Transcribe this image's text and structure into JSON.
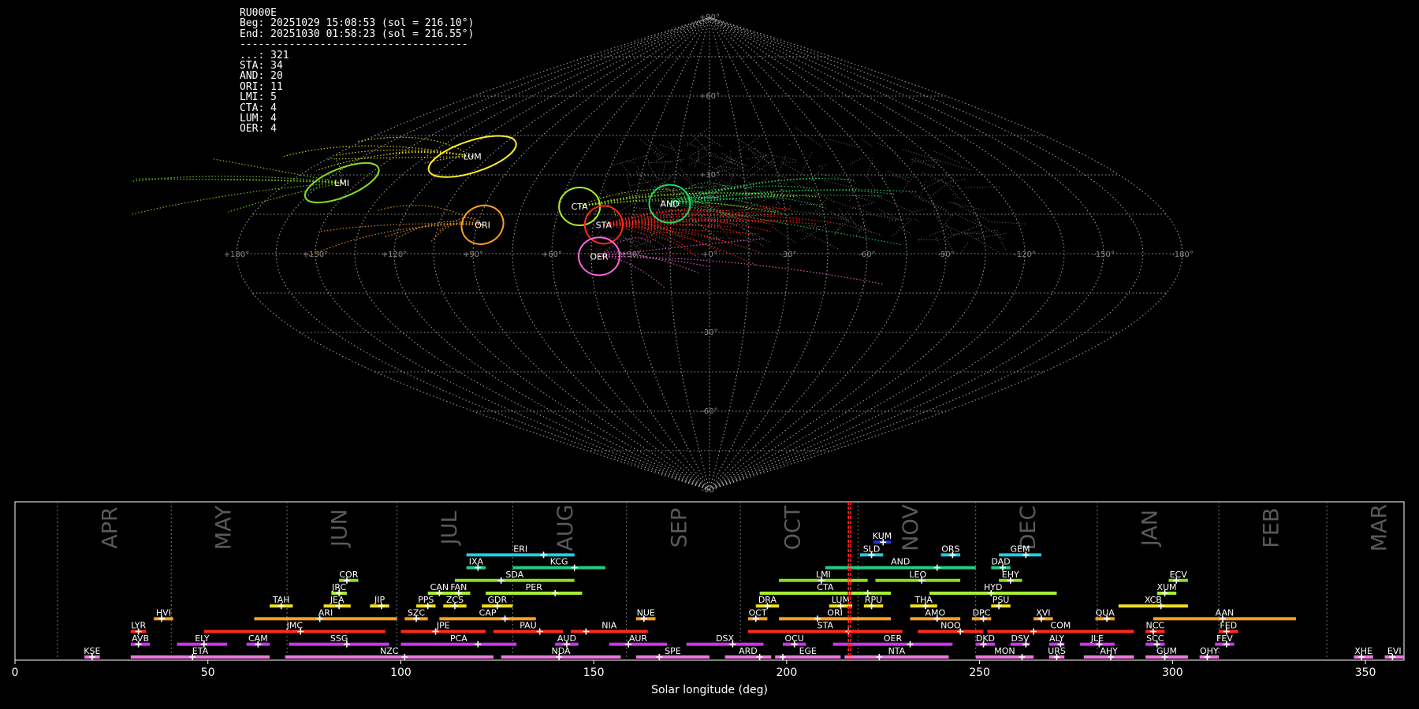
{
  "station": "RU000E",
  "beg_line": "Beg: 20251029 15:08:53 (sol = 216.10°)",
  "end_line": "End: 20251030 01:58:23 (sol = 216.55°)",
  "separator": "-------------------------------------",
  "counts": [
    {
      "code": "...",
      "n": 321
    },
    {
      "code": "STA",
      "n": 34
    },
    {
      "code": "AND",
      "n": 20
    },
    {
      "code": "ORI",
      "n": 11
    },
    {
      "code": "LMI",
      "n": 5
    },
    {
      "code": "CTA",
      "n": 4
    },
    {
      "code": "LUM",
      "n": 4
    },
    {
      "code": "OER",
      "n": 4
    }
  ],
  "colors": {
    "background": "#000000",
    "grid": "#9a9a9a",
    "sporadic": "#8a8a8a",
    "current": "#ff2020"
  },
  "chart_data": [
    {
      "type": "scatter",
      "projection": "sinusoidal",
      "lon_ticks": [
        "+180°",
        "+150°",
        "+120°",
        "+90°",
        "+60°",
        "+30°",
        "+0°",
        "-30°",
        "-60°",
        "-90°",
        "-120°",
        "-150°",
        "-180°"
      ],
      "lat_ticks": [
        "+90°",
        "+60°",
        "+30°",
        "-30°",
        "-60°",
        "-90°"
      ],
      "showers": [
        {
          "code": "LUM",
          "lon": 113,
          "lat": 37,
          "color": "#ffee22"
        },
        {
          "code": "LMI",
          "lon": 157,
          "lat": 27,
          "color": "#88dd22"
        },
        {
          "code": "CTA",
          "lon": 52,
          "lat": 18,
          "color": "#aaee22"
        },
        {
          "code": "AND",
          "lon": 16,
          "lat": 19,
          "color": "#22dd66"
        },
        {
          "code": "ORI",
          "lon": 88,
          "lat": 11,
          "color": "#ffa020"
        },
        {
          "code": "STA",
          "lon": 41,
          "lat": 11,
          "color": "#ff2a1a"
        },
        {
          "code": "OER",
          "lon": 42,
          "lat": -1,
          "color": "#ff66dd"
        }
      ]
    },
    {
      "type": "bar",
      "title": "",
      "xlabel": "Solar longitude (deg)",
      "xlim": [
        0,
        360
      ],
      "xticks": [
        0,
        50,
        100,
        150,
        200,
        250,
        300,
        350
      ],
      "current_sol": 216.3,
      "months": [
        {
          "name": "APR",
          "sol": 11
        },
        {
          "name": "MAY",
          "sol": 40.5
        },
        {
          "name": "JUN",
          "sol": 70.5
        },
        {
          "name": "JUL",
          "sol": 99
        },
        {
          "name": "AUG",
          "sol": 129
        },
        {
          "name": "SEP",
          "sol": 158.5
        },
        {
          "name": "OCT",
          "sol": 188
        },
        {
          "name": "NOV",
          "sol": 218.5
        },
        {
          "name": "DEC",
          "sol": 249
        },
        {
          "name": "JAN",
          "sol": 280.5
        },
        {
          "name": "FEB",
          "sol": 312
        },
        {
          "name": "MAR",
          "sol": 340
        }
      ],
      "showers": [
        {
          "code": "KUM",
          "start": 222.5,
          "end": 227,
          "peak": 225,
          "row": 10,
          "color": "#2233dd"
        },
        {
          "code": "ERI",
          "start": 117,
          "end": 145,
          "peak": 137,
          "row": 9,
          "color": "#22ccdd"
        },
        {
          "code": "SLD",
          "start": 219,
          "end": 225,
          "peak": 222,
          "row": 9,
          "color": "#22ccdd"
        },
        {
          "code": "ORS",
          "start": 240,
          "end": 245,
          "peak": 243,
          "row": 9,
          "color": "#22ccdd"
        },
        {
          "code": "GEM",
          "start": 255,
          "end": 266,
          "peak": 262,
          "row": 9,
          "color": "#22ccdd"
        },
        {
          "code": "IXA",
          "start": 117,
          "end": 122,
          "peak": 120,
          "row": 8,
          "color": "#22cc88"
        },
        {
          "code": "KCG",
          "start": 129,
          "end": 153,
          "peak": 145,
          "row": 8,
          "color": "#22cc88"
        },
        {
          "code": "AND",
          "start": 210,
          "end": 249,
          "peak": 239,
          "row": 8,
          "color": "#22cc88"
        },
        {
          "code": "DAD",
          "start": 253,
          "end": 258,
          "peak": 256,
          "row": 8,
          "color": "#22cc88"
        },
        {
          "code": "COR",
          "start": 84,
          "end": 89,
          "peak": 86,
          "row": 7,
          "color": "#88dd22"
        },
        {
          "code": "SDA",
          "start": 114,
          "end": 145,
          "peak": 126,
          "row": 7,
          "color": "#88dd22"
        },
        {
          "code": "LMI",
          "start": 198,
          "end": 221,
          "peak": 209,
          "row": 7,
          "color": "#88dd22"
        },
        {
          "code": "LEO",
          "start": 223,
          "end": 245,
          "peak": 235,
          "row": 7,
          "color": "#88dd22"
        },
        {
          "code": "EHY",
          "start": 255,
          "end": 261,
          "peak": 258,
          "row": 7,
          "color": "#88dd22"
        },
        {
          "code": "ECV",
          "start": 299,
          "end": 304,
          "peak": 301,
          "row": 7,
          "color": "#88dd22"
        },
        {
          "code": "JRC",
          "start": 82,
          "end": 86,
          "peak": 84,
          "row": 6,
          "color": "#aaee33"
        },
        {
          "code": "CAN",
          "start": 107,
          "end": 113,
          "peak": 110,
          "row": 6,
          "color": "#aaee33"
        },
        {
          "code": "FAN",
          "start": 112,
          "end": 118,
          "peak": 115,
          "row": 6,
          "color": "#aaee33"
        },
        {
          "code": "PER",
          "start": 122,
          "end": 147,
          "peak": 140,
          "row": 6,
          "color": "#aaee33"
        },
        {
          "code": "CTA",
          "start": 193,
          "end": 227,
          "peak": 221,
          "row": 6,
          "color": "#aaee33"
        },
        {
          "code": "HYD",
          "start": 237,
          "end": 270,
          "peak": 253,
          "row": 6,
          "color": "#aaee33"
        },
        {
          "code": "XUM",
          "start": 296,
          "end": 301,
          "peak": 298,
          "row": 6,
          "color": "#aaee33"
        },
        {
          "code": "TAH",
          "start": 66,
          "end": 72,
          "peak": 69,
          "row": 5,
          "color": "#eedd22"
        },
        {
          "code": "JEA",
          "start": 80,
          "end": 87,
          "peak": 84,
          "row": 5,
          "color": "#eedd22"
        },
        {
          "code": "JIP",
          "start": 92,
          "end": 97,
          "peak": 95,
          "row": 5,
          "color": "#eedd22"
        },
        {
          "code": "PPS",
          "start": 104,
          "end": 109,
          "peak": 107,
          "row": 5,
          "color": "#eedd22"
        },
        {
          "code": "ZCS",
          "start": 111,
          "end": 117,
          "peak": 114,
          "row": 5,
          "color": "#eedd22"
        },
        {
          "code": "GDR",
          "start": 121,
          "end": 129,
          "peak": 125,
          "row": 5,
          "color": "#eedd22"
        },
        {
          "code": "DRA",
          "start": 192,
          "end": 198,
          "peak": 195,
          "row": 5,
          "color": "#eedd22"
        },
        {
          "code": "LUM",
          "start": 211,
          "end": 217,
          "peak": 214,
          "row": 5,
          "color": "#eedd22"
        },
        {
          "code": "RPU",
          "start": 220,
          "end": 225,
          "peak": 222,
          "row": 5,
          "color": "#eedd22"
        },
        {
          "code": "THA",
          "start": 232,
          "end": 239,
          "peak": 236,
          "row": 5,
          "color": "#eedd22"
        },
        {
          "code": "PSU",
          "start": 253,
          "end": 258,
          "peak": 255,
          "row": 5,
          "color": "#eedd22"
        },
        {
          "code": "XCB",
          "start": 286,
          "end": 304,
          "peak": 297,
          "row": 5,
          "color": "#eedd22"
        },
        {
          "code": "HVI",
          "start": 36,
          "end": 41,
          "peak": 38,
          "row": 4,
          "color": "#ffa020"
        },
        {
          "code": "ARI",
          "start": 62,
          "end": 99,
          "peak": 79,
          "row": 4,
          "color": "#ffa020"
        },
        {
          "code": "SZC",
          "start": 101,
          "end": 107,
          "peak": 104,
          "row": 4,
          "color": "#ffa020"
        },
        {
          "code": "CAP",
          "start": 110,
          "end": 135,
          "peak": 127,
          "row": 4,
          "color": "#ffa020"
        },
        {
          "code": "NUE",
          "start": 161,
          "end": 166,
          "peak": 163,
          "row": 4,
          "color": "#ffa020"
        },
        {
          "code": "OCT",
          "start": 190,
          "end": 195,
          "peak": 192,
          "row": 4,
          "color": "#ffa020"
        },
        {
          "code": "ORI",
          "start": 198,
          "end": 227,
          "peak": 208,
          "row": 4,
          "color": "#ffa020"
        },
        {
          "code": "AMO",
          "start": 232,
          "end": 245,
          "peak": 239,
          "row": 4,
          "color": "#ffa020"
        },
        {
          "code": "DPC",
          "start": 248,
          "end": 253,
          "peak": 251,
          "row": 4,
          "color": "#ffa020"
        },
        {
          "code": "XVI",
          "start": 264,
          "end": 269,
          "peak": 266,
          "row": 4,
          "color": "#ffa020"
        },
        {
          "code": "QUA",
          "start": 280,
          "end": 285,
          "peak": 283,
          "row": 4,
          "color": "#ffa020"
        },
        {
          "code": "AAN",
          "start": 295,
          "end": 332,
          "peak": 313,
          "row": 4,
          "color": "#ffa020"
        },
        {
          "code": "LYR",
          "start": 30,
          "end": 34,
          "peak": 32,
          "row": 3,
          "color": "#ff2a1a"
        },
        {
          "code": "JMC",
          "start": 49,
          "end": 96,
          "peak": 74,
          "row": 3,
          "color": "#ff2a1a"
        },
        {
          "code": "JPE",
          "start": 100,
          "end": 122,
          "peak": 109,
          "row": 3,
          "color": "#ff2a1a"
        },
        {
          "code": "PAU",
          "start": 124,
          "end": 142,
          "peak": 136,
          "row": 3,
          "color": "#ff2a1a"
        },
        {
          "code": "NIA",
          "start": 144,
          "end": 164,
          "peak": 148,
          "row": 3,
          "color": "#ff2a1a"
        },
        {
          "code": "STA",
          "start": 190,
          "end": 230,
          "peak": 216,
          "row": 3,
          "color": "#ff2a1a"
        },
        {
          "code": "NOO",
          "start": 234,
          "end": 251,
          "peak": 245,
          "row": 3,
          "color": "#ff2a1a"
        },
        {
          "code": "COM",
          "start": 252,
          "end": 290,
          "peak": 264,
          "row": 3,
          "color": "#ff2a1a"
        },
        {
          "code": "NCC",
          "start": 293,
          "end": 298,
          "peak": 295,
          "row": 3,
          "color": "#ff2a1a"
        },
        {
          "code": "FED",
          "start": 312,
          "end": 317,
          "peak": 314,
          "row": 3,
          "color": "#ff2a1a"
        },
        {
          "code": "AVB",
          "start": 30,
          "end": 35,
          "peak": 32,
          "row": 2,
          "color": "#cc33ee"
        },
        {
          "code": "ELY",
          "start": 42,
          "end": 55,
          "peak": 49,
          "row": 2,
          "color": "#cc33ee"
        },
        {
          "code": "CAM",
          "start": 60,
          "end": 66,
          "peak": 63,
          "row": 2,
          "color": "#cc33ee"
        },
        {
          "code": "SSG",
          "start": 71,
          "end": 97,
          "peak": 86,
          "row": 2,
          "color": "#cc33ee"
        },
        {
          "code": "PCA",
          "start": 100,
          "end": 130,
          "peak": 120,
          "row": 2,
          "color": "#cc33ee"
        },
        {
          "code": "AUD",
          "start": 140,
          "end": 146,
          "peak": 143,
          "row": 2,
          "color": "#cc33ee"
        },
        {
          "code": "AUR",
          "start": 154,
          "end": 169,
          "peak": 159,
          "row": 2,
          "color": "#cc33ee"
        },
        {
          "code": "DSX",
          "start": 174,
          "end": 194,
          "peak": 186,
          "row": 2,
          "color": "#cc33ee"
        },
        {
          "code": "OCU",
          "start": 199,
          "end": 205,
          "peak": 202,
          "row": 2,
          "color": "#cc33ee"
        },
        {
          "code": "OER",
          "start": 212,
          "end": 243,
          "peak": 232,
          "row": 2,
          "color": "#cc33ee"
        },
        {
          "code": "DKD",
          "start": 249,
          "end": 254,
          "peak": 251,
          "row": 2,
          "color": "#cc33ee"
        },
        {
          "code": "DSV",
          "start": 258,
          "end": 263,
          "peak": 262,
          "row": 2,
          "color": "#cc33ee"
        },
        {
          "code": "ALY",
          "start": 268,
          "end": 272,
          "peak": 271,
          "row": 2,
          "color": "#cc33ee"
        },
        {
          "code": "JLE",
          "start": 276,
          "end": 285,
          "peak": 281,
          "row": 2,
          "color": "#cc33ee"
        },
        {
          "code": "SCC",
          "start": 293,
          "end": 298,
          "peak": 296,
          "row": 2,
          "color": "#cc33ee"
        },
        {
          "code": "FEV",
          "start": 311,
          "end": 316,
          "peak": 314,
          "row": 2,
          "color": "#cc33ee"
        },
        {
          "code": "KSE",
          "start": 18,
          "end": 22,
          "peak": 20,
          "row": 1,
          "color": "#ee77dd"
        },
        {
          "code": "ETA",
          "start": 30,
          "end": 66,
          "peak": 46,
          "row": 1,
          "color": "#ee77dd"
        },
        {
          "code": "NZC",
          "start": 70,
          "end": 124,
          "peak": 101,
          "row": 1,
          "color": "#ee77dd"
        },
        {
          "code": "NDA",
          "start": 126,
          "end": 157,
          "peak": 141,
          "row": 1,
          "color": "#ee77dd"
        },
        {
          "code": "SPE",
          "start": 161,
          "end": 180,
          "peak": 167,
          "row": 1,
          "color": "#ee77dd"
        },
        {
          "code": "ARD",
          "start": 184,
          "end": 196,
          "peak": 193,
          "row": 1,
          "color": "#ee77dd"
        },
        {
          "code": "EGE",
          "start": 197,
          "end": 214,
          "peak": 199,
          "row": 1,
          "color": "#ee77dd"
        },
        {
          "code": "NTA",
          "start": 215,
          "end": 242,
          "peak": 224,
          "row": 1,
          "color": "#ee77dd"
        },
        {
          "code": "MON",
          "start": 249,
          "end": 264,
          "peak": 261,
          "row": 1,
          "color": "#ee77dd"
        },
        {
          "code": "URS",
          "start": 268,
          "end": 272,
          "peak": 270,
          "row": 1,
          "color": "#ee77dd"
        },
        {
          "code": "AHY",
          "start": 277,
          "end": 290,
          "peak": 284,
          "row": 1,
          "color": "#ee77dd"
        },
        {
          "code": "GUM",
          "start": 293,
          "end": 304,
          "peak": 298,
          "row": 1,
          "color": "#ee77dd"
        },
        {
          "code": "OHY",
          "start": 307,
          "end": 312,
          "peak": 309,
          "row": 1,
          "color": "#ee77dd"
        },
        {
          "code": "XHE",
          "start": 347,
          "end": 352,
          "peak": 349,
          "row": 1,
          "color": "#ee77dd"
        },
        {
          "code": "EVI",
          "start": 355,
          "end": 360,
          "peak": 357,
          "row": 1,
          "color": "#ee77dd"
        }
      ]
    }
  ]
}
